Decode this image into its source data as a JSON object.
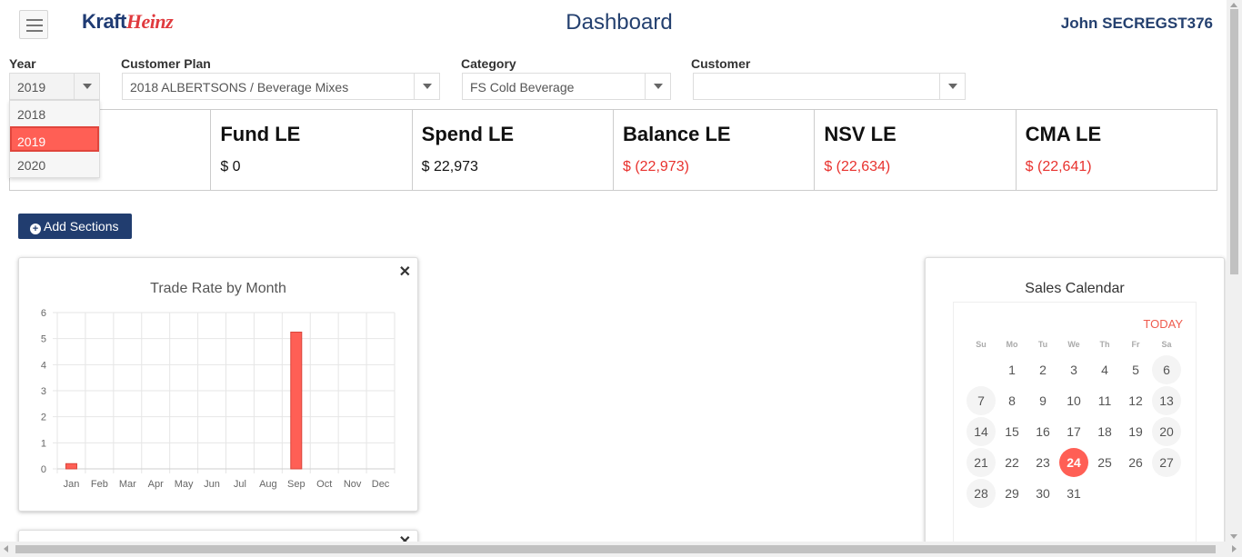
{
  "header": {
    "logo_kraft": "Kraft",
    "logo_heinz": "Heinz",
    "title": "Dashboard",
    "user": "John SECREGST376"
  },
  "filters": {
    "year": {
      "label": "Year",
      "value": "2019",
      "options": [
        "2018",
        "2019",
        "2020"
      ]
    },
    "customer_plan": {
      "label": "Customer Plan",
      "value": "2018 ALBERTSONS / Beverage Mixes"
    },
    "category": {
      "label": "Category",
      "value": "FS Cold Beverage"
    },
    "customer": {
      "label": "Customer",
      "value": ""
    }
  },
  "kpis": [
    {
      "title": "Fund LE",
      "value": "$ 0",
      "negative": false
    },
    {
      "title": "Spend LE",
      "value": "$ 22,973",
      "negative": false
    },
    {
      "title": "Balance LE",
      "value": "$ (22,973)",
      "negative": true
    },
    {
      "title": "NSV LE",
      "value": "$ (22,634)",
      "negative": true
    },
    {
      "title": "CMA LE",
      "value": "$ (22,641)",
      "negative": true
    }
  ],
  "add_sections_label": "Add Sections",
  "close_glyph": "✕",
  "chart_panel": {
    "chart_data": {
      "type": "bar",
      "title": "Trade Rate by Month",
      "categories": [
        "Jan",
        "Feb",
        "Mar",
        "Apr",
        "May",
        "Jun",
        "Jul",
        "Aug",
        "Sep",
        "Oct",
        "Nov",
        "Dec"
      ],
      "values": [
        0.2,
        0,
        0,
        0,
        0,
        0,
        0,
        0,
        5.25,
        0,
        0,
        0
      ],
      "yticks": [
        "0",
        "1",
        "2",
        "3",
        "4",
        "5",
        "6"
      ],
      "ylim": [
        0,
        6
      ],
      "xlabel": "",
      "ylabel": "",
      "grid": true,
      "color": "#ff5f55"
    }
  },
  "calendar": {
    "title": "Sales Calendar",
    "today_label": "TODAY",
    "weekdays": [
      "Su",
      "Mo",
      "Tu",
      "We",
      "Th",
      "Fr",
      "Sa"
    ],
    "first_weekday": 1,
    "days_in_month": 31,
    "current_day": 24,
    "accent": "#ff5f55"
  }
}
